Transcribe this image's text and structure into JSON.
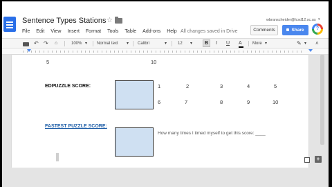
{
  "doc": {
    "title": "Sentence Types Stations",
    "user_email": "wbranscheider@lcsd12.sc.us",
    "save_status": "All changes saved in Drive"
  },
  "menu": [
    "File",
    "Edit",
    "View",
    "Insert",
    "Format",
    "Tools",
    "Table",
    "Add-ons",
    "Help"
  ],
  "header_buttons": {
    "comments": "Comments",
    "share": "Share",
    "explore": "?"
  },
  "toolbar": {
    "zoom": "100%",
    "style": "Normal text",
    "font": "Calibri",
    "size": "12",
    "bold": "B",
    "italic": "I",
    "underline": "U",
    "text_color": "A",
    "more": "More",
    "caret": "▾",
    "collapse": "˄"
  },
  "content": {
    "top_row": {
      "left": "5",
      "right": "10"
    },
    "edpuzzle_label": "EDPUZZLE SCORE:",
    "edpuzzle_numbers_row1": [
      "1",
      "2",
      "3",
      "4",
      "5"
    ],
    "edpuzzle_numbers_row2": [
      "6",
      "7",
      "8",
      "9",
      "10"
    ],
    "fastest_label": "FASTEST PUZZLE SCORE:",
    "fastest_question": "How many times I timed myself to get this score: ____"
  },
  "colors": {
    "share_blue": "#4a87ee",
    "score_box_fill": "#cfe0f2",
    "link_blue": "#1f5fa8"
  },
  "icons": [
    "docs-logo-icon",
    "star-icon",
    "folder-icon",
    "print-icon",
    "undo-icon",
    "redo-icon",
    "paint-format-icon",
    "pencil-icon",
    "add-comment-icon",
    "explore-icon"
  ]
}
